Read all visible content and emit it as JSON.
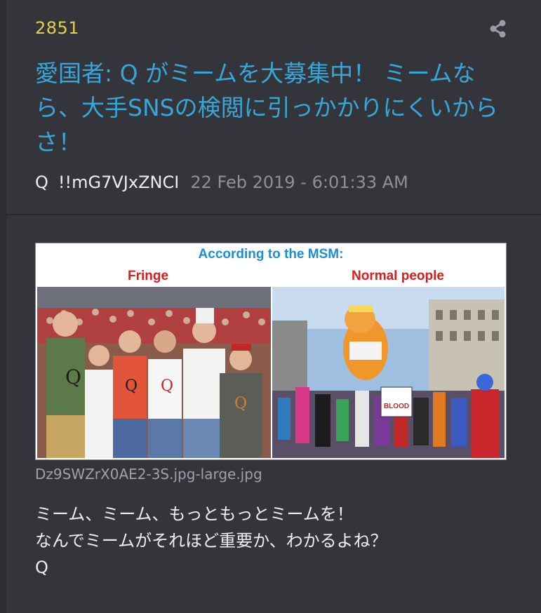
{
  "post": {
    "number": "2851",
    "title": "愛国者: Q がミームを大募集中！ ミームなら、大手SNSの検閲に引っかかりにくいからさ！",
    "author": "Q",
    "tripcode": "!!mG7VJxZNCI",
    "timestamp": "22 Feb 2019 - 6:01:33 AM",
    "share_icon": "share-icon"
  },
  "image": {
    "heading": "According to the MSM:",
    "left_label": "Fringe",
    "right_label": "Normal people",
    "sign_text": "BLOOD",
    "filename": "Dz9SWZrX0AE2-3S.jpg-large.jpg"
  },
  "body": {
    "line1": "ミーム、ミーム、もっともっとミームを！",
    "line2": "なんでミームがそれほど重要か、わかるよね？",
    "line3": "Q"
  },
  "colors": {
    "background": "#33353b",
    "number": "#e6cf4a",
    "title": "#37a6d8",
    "text": "#eceef1",
    "muted": "#8e9197",
    "image_heading": "#1a8fd6",
    "image_label": "#e01b1b"
  }
}
